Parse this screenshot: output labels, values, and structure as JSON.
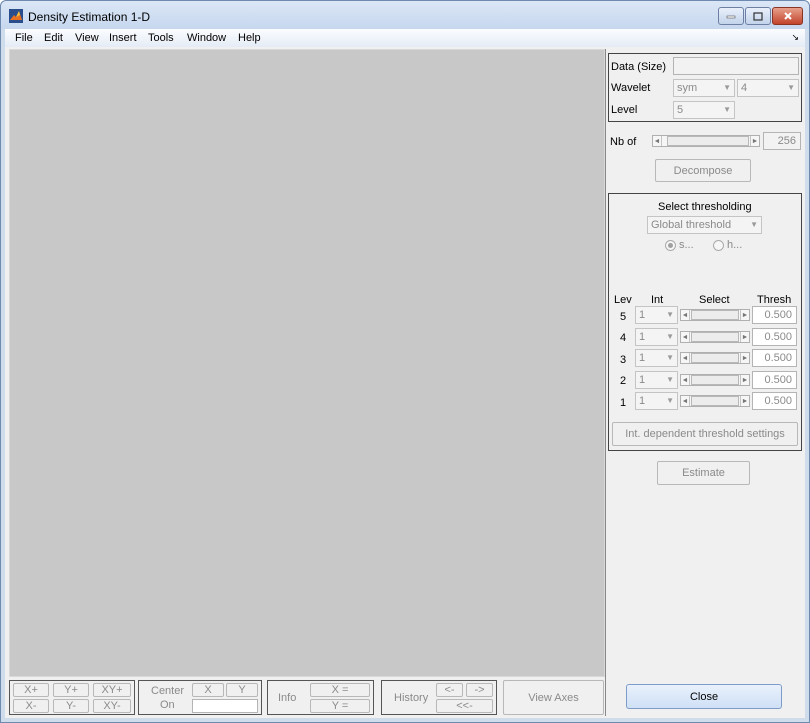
{
  "window": {
    "title": "Density Estimation 1-D",
    "minimize_icon": "minimize-icon",
    "maximize_icon": "maximize-icon",
    "close_icon": "close-icon"
  },
  "menubar": {
    "items": [
      "File",
      "Edit",
      "View",
      "Insert",
      "Tools",
      "Window",
      "Help"
    ],
    "dock_arrow": "↘"
  },
  "data_panel": {
    "data_label": "Data  (Size)",
    "data_value": "",
    "wavelet_label": "Wavelet",
    "wavelet_family": "sym",
    "wavelet_order": "4",
    "level_label": "Level",
    "level_value": "5"
  },
  "nb_of": {
    "label": "Nb of",
    "value": "256"
  },
  "decompose_label": "Decompose",
  "threshold_panel": {
    "title": "Select thresholding",
    "method": "Global threshold",
    "radio_soft": "s...",
    "radio_hard": "h...",
    "headers": {
      "lev": "Lev",
      "int": "Int",
      "select": "Select",
      "thresh": "Thresh"
    },
    "rows": [
      {
        "lev": "5",
        "int": "1",
        "thresh": "0.500"
      },
      {
        "lev": "4",
        "int": "1",
        "thresh": "0.500"
      },
      {
        "lev": "3",
        "int": "1",
        "thresh": "0.500"
      },
      {
        "lev": "2",
        "int": "1",
        "thresh": "0.500"
      },
      {
        "lev": "1",
        "int": "1",
        "thresh": "0.500"
      }
    ],
    "int_settings": "Int. dependent threshold settings"
  },
  "estimate_label": "Estimate",
  "close_label": "Close",
  "bottom": {
    "zoom": {
      "xplus": "X+",
      "yplus": "Y+",
      "xyplus": "XY+",
      "xminus": "X-",
      "yminus": "Y-",
      "xyminus": "XY-"
    },
    "center": {
      "label1": "Center",
      "label2": "On",
      "x": "X",
      "y": "Y"
    },
    "info": {
      "label": "Info",
      "x": "X =",
      "y": "Y ="
    },
    "history": {
      "label": "History",
      "back": "<-",
      "forward": "->",
      "first": "<<-"
    },
    "view_axes": "View Axes"
  }
}
